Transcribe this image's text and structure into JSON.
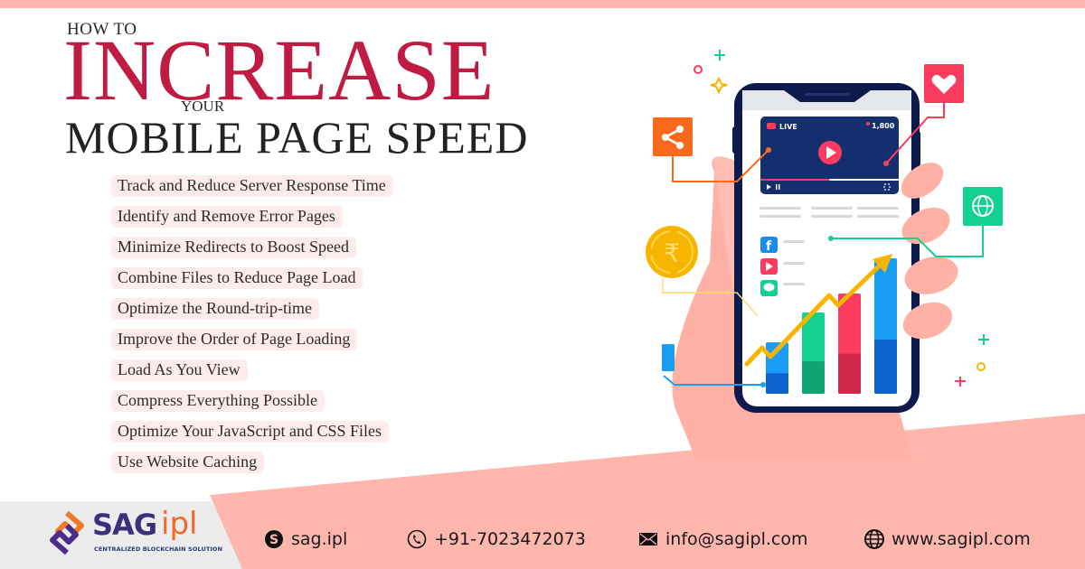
{
  "header": {
    "line1": "HOW TO",
    "line2": "INCREASE",
    "line3": "YOUR",
    "line4": "MOBILE PAGE SPEED"
  },
  "tips": [
    "Track and Reduce Server Response Time",
    "Identify and Remove Error Pages",
    "Minimize Redirects to Boost Speed",
    "Combine Files to Reduce Page Load",
    "Optimize the Round-trip-time",
    "Improve the Order of Page Loading",
    "Load As You View",
    "Compress Everything Possible",
    "Optimize Your JavaScript and CSS Files",
    "Use Website Caching"
  ],
  "illustration": {
    "live_label": "LIVE",
    "viewer_count": "1,800",
    "video_progress": 0.5,
    "currency_symbol": "₹",
    "bar_chart_relative_values": [
      0.38,
      0.6,
      0.74,
      1.0
    ],
    "bar_colors": [
      "#1a9df5",
      "#13d18e",
      "#fb3c5e",
      "#1a9df5"
    ],
    "social_icons": [
      "facebook-icon",
      "youtube-icon",
      "chat-icon"
    ],
    "floating_icons": [
      "share-icon",
      "heart-icon",
      "globe-icon",
      "rupee-coin-icon"
    ]
  },
  "footer": {
    "brand": "SAG",
    "brand_suffix": "ipl",
    "tagline": "CENTRALIZED BLOCKCHAIN SOLUTION",
    "skype": "sag.ipl",
    "phone": "+91-7023472073",
    "email": "info@sagipl.com",
    "website": "www.sagipl.com"
  },
  "colors": {
    "accent_red": "#c01c43",
    "pink": "#ffb7ad",
    "chip_bg": "#fdeceb",
    "phone_navy": "#0d1b4c"
  }
}
